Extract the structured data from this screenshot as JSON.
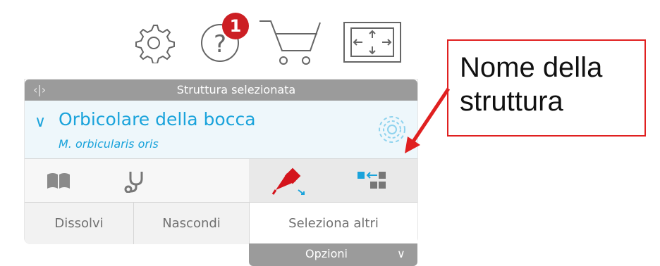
{
  "toolbar": {
    "help_badge_count": "1",
    "icons": [
      "gear-icon",
      "help-icon",
      "cart-icon",
      "fullscreen-icon"
    ]
  },
  "panel": {
    "header_title": "Struttura selezionata",
    "structure_name": "Orbicolare della bocca",
    "structure_latin": "M. orbicularis oris",
    "buttons": {
      "fade": "Dissolvi",
      "hide": "Nascondi",
      "select_others": "Seleziona altri"
    },
    "options_label": "Opzioni"
  },
  "annotation": {
    "text_line1": "Nome della",
    "text_line2": "struttura"
  },
  "colors": {
    "accent": "#1aa3db",
    "header_gray": "#9b9b9b",
    "badge_red": "#cc1f24",
    "annotation_red": "#e02020",
    "pin_red": "#d4141c"
  }
}
